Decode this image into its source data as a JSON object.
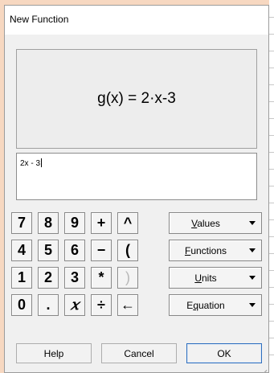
{
  "dialog": {
    "title": "New Function",
    "display_formula": "g(x) = 2·x-3",
    "input_value": "2x - 3"
  },
  "keypad": {
    "keys": [
      "7",
      "8",
      "9",
      "+",
      "^",
      "4",
      "5",
      "6",
      "−",
      "(",
      "1",
      "2",
      "3",
      "*",
      ")",
      "0",
      ".",
      "𝑥",
      "÷",
      "←"
    ]
  },
  "dropdowns": [
    {
      "label": "Values",
      "mnemonic": "V",
      "rest": "alues"
    },
    {
      "label": "Functions",
      "mnemonic": "F",
      "rest": "unctions"
    },
    {
      "label": "Units",
      "mnemonic": "U",
      "rest": "nits"
    },
    {
      "label": "Equation",
      "mnemonic": "q",
      "prefix": "E",
      "rest": "uation"
    }
  ],
  "buttons": {
    "help": "Help",
    "cancel": "Cancel",
    "ok": "OK"
  },
  "colors": {
    "background": "#f7d8c1",
    "dialog_bg": "#f0f0f0",
    "ok_border": "#2f6fbf",
    "disabled_text": "#b8b8b8"
  }
}
